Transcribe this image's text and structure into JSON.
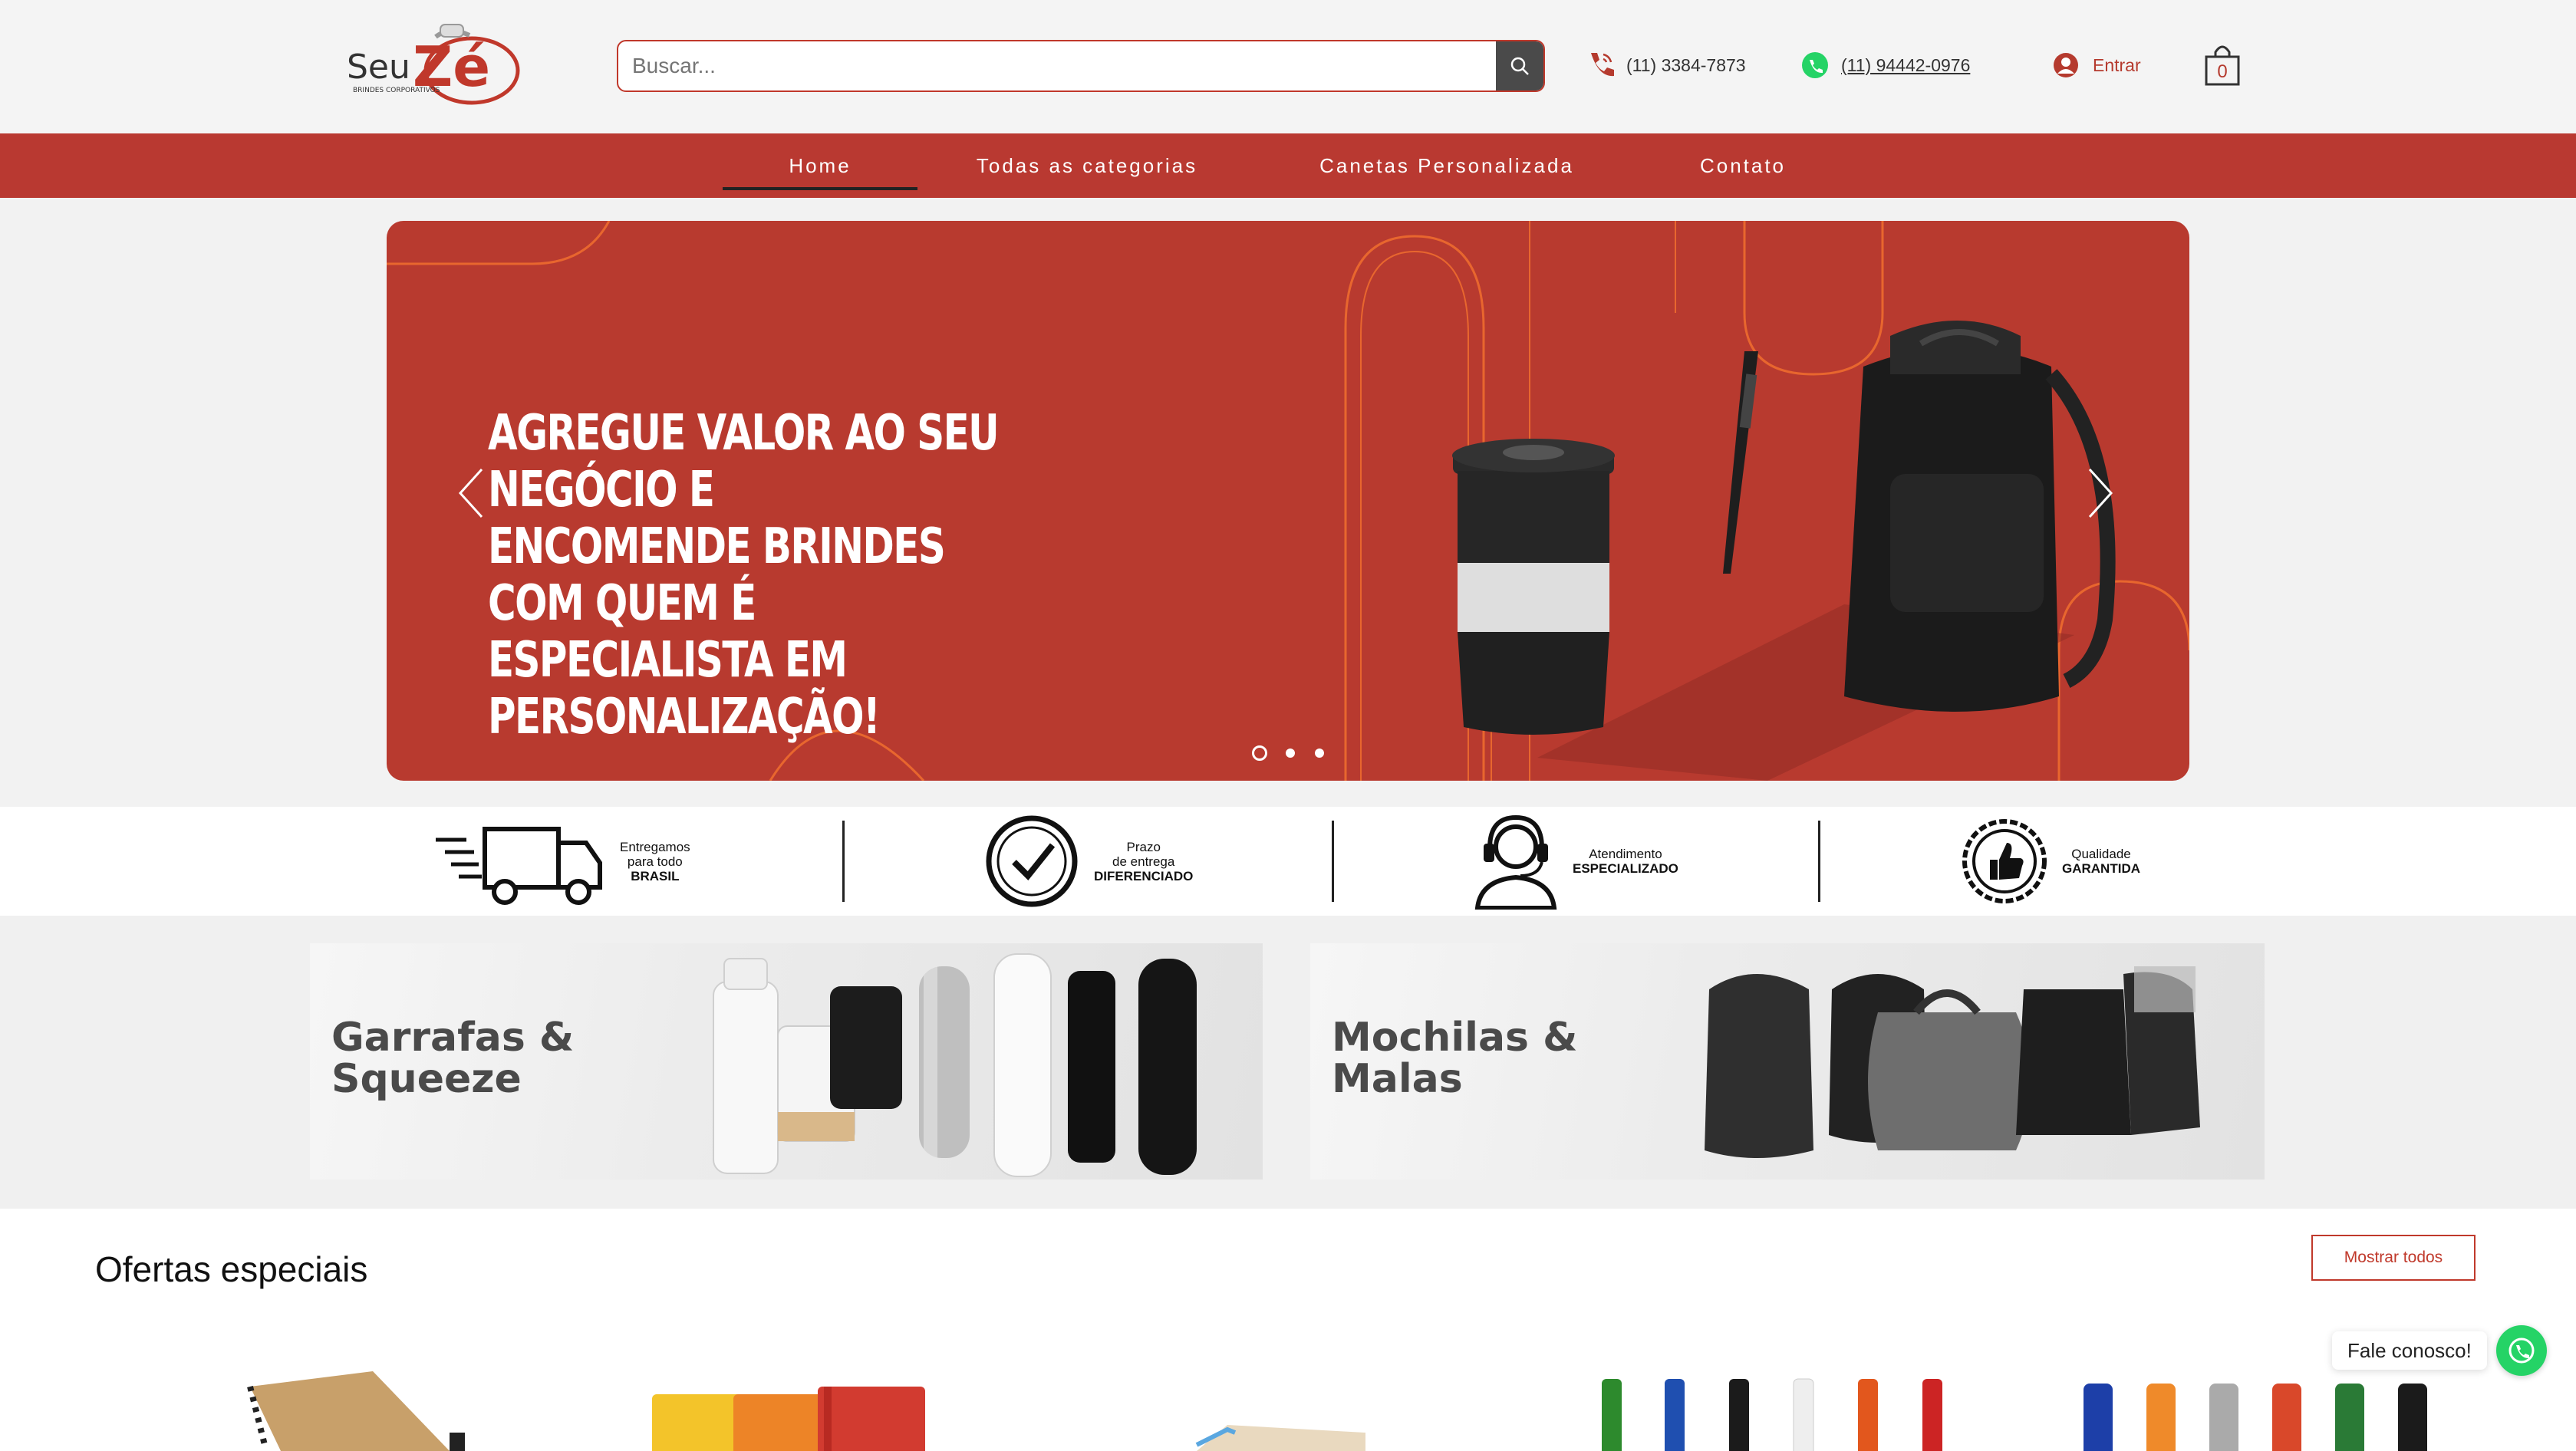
{
  "header": {
    "logo_text": "Seu Zé",
    "logo_sub": "BRINDES CORPORATIVOS",
    "search_placeholder": "Buscar...",
    "phone": "(11) 3384-7873",
    "whatsapp": "(11) 94442-0976",
    "login_label": "Entrar",
    "cart_count": "0"
  },
  "nav": {
    "items": [
      {
        "label": "Home",
        "active": true
      },
      {
        "label": "Todas as categorias",
        "active": false
      },
      {
        "label": "Canetas Personalizada",
        "active": false
      },
      {
        "label": "Contato",
        "active": false
      }
    ]
  },
  "hero": {
    "line1": "AGREGUE VALOR AO SEU NEGÓCIO E",
    "line2": "ENCOMENDE BRINDES COM QUEM É",
    "line3": "ESPECIALISTA EM PERSONALIZAÇÃO!",
    "slide_count": 3,
    "active_slide": 1
  },
  "features": [
    {
      "line1": "Entregamos",
      "line2": "para todo",
      "line3": "BRASIL",
      "icon": "truck-icon"
    },
    {
      "line1": "Prazo",
      "line2": "de entrega",
      "line3": "DIFERENCIADO",
      "icon": "clock-check-icon"
    },
    {
      "line1": "Atendimento",
      "line2": "ESPECIALIZADO",
      "line3": "",
      "icon": "headset-icon"
    },
    {
      "line1": "Qualidade",
      "line2": "GARANTIDA",
      "line3": "",
      "icon": "thumbs-up-badge-icon"
    }
  ],
  "categories": [
    {
      "line1": "Garrafas &",
      "line2": "Squeeze"
    },
    {
      "line1": "Mochilas &",
      "line2": "Malas"
    }
  ],
  "offers": {
    "title": "Ofertas especiais",
    "show_all": "Mostrar todos"
  },
  "chat": {
    "label": "Fale conosco!"
  },
  "colors": {
    "brand_red": "#b93931",
    "whatsapp_green": "#25d366"
  }
}
